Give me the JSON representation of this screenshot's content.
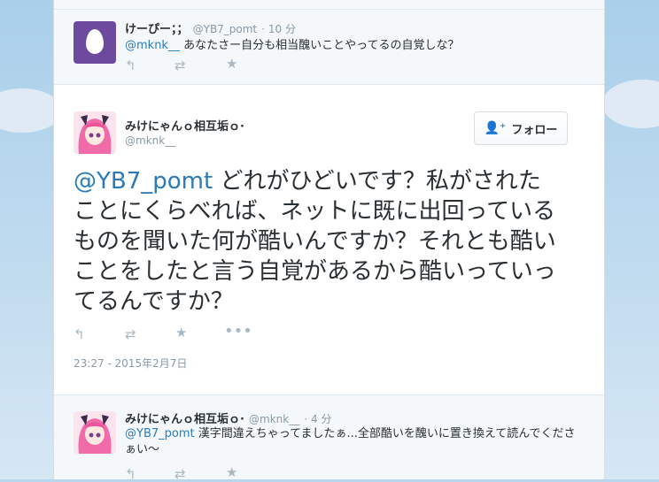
{
  "top_tweet": {
    "name": "けーぴー；；",
    "handle": "@YB7_pomt",
    "time": "· 10 分",
    "mention": "@mknk__",
    "text": " あなたさー自分も相当醜いことやってるの自覚しな？"
  },
  "main_tweet": {
    "name": "みけにゃんｏ相互垢ｏ·",
    "handle": "@mknk__",
    "follow_label": "フォロー",
    "mention": "@YB7_pomt",
    "text": " どれがひどいです？私がされたことにくらべれば、ネットに既に出回っているものを聞いた何が酷いんですか？それとも酷いことをしたと言う自覚があるから酷いっていってるんですか？",
    "timestamp": "23:27 - 2015年2月7日"
  },
  "reply_tweet": {
    "name": "みけにゃんｏ相互垢ｏ·",
    "handle": "@mknk__",
    "time": "· 4 分",
    "mention": "@YB7_pomt",
    "text": " 漢字間違えちゃってましたぁ...全部酷いを醜いに置き換えて読んでくださぁい〜"
  },
  "icons": {
    "reply": "reply-icon",
    "retweet": "retweet-icon",
    "favorite": "star-icon",
    "more": "more-icon",
    "follow": "add-user-icon"
  },
  "colors": {
    "link": "#2b7bb9",
    "text": "#292f33",
    "muted": "#8899a6",
    "background_sky": "#b9d6ec"
  }
}
